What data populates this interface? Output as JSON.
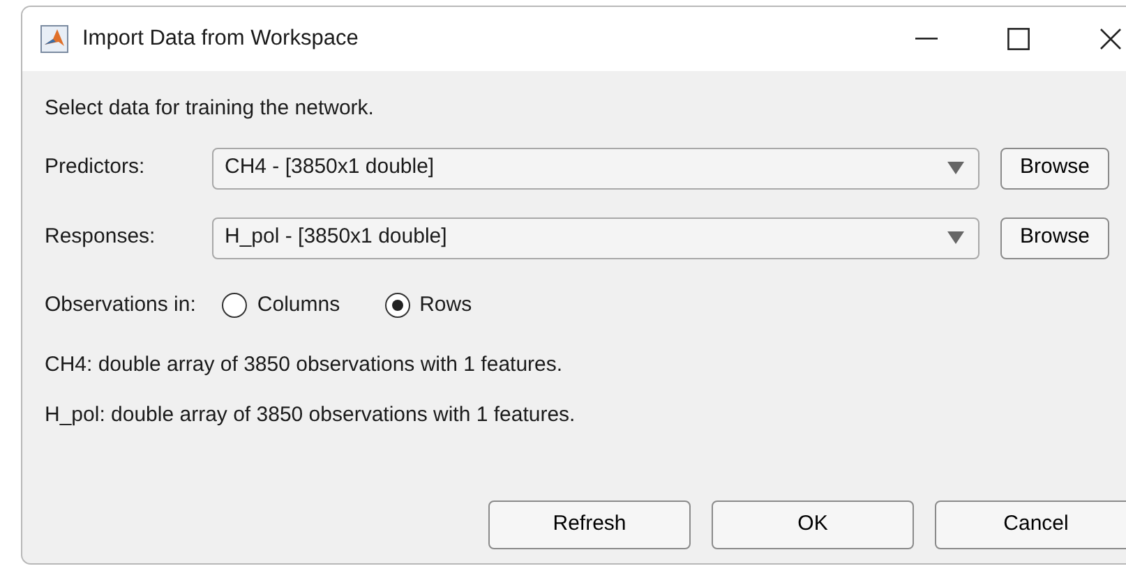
{
  "window": {
    "title": "Import Data from Workspace"
  },
  "instruction": "Select data for training the network.",
  "fields": [
    {
      "label": "Predictors:",
      "value": "CH4 - [3850x1 double]",
      "button": "Browse"
    },
    {
      "label": "Responses:",
      "value": "H_pol - [3850x1 double]",
      "button": "Browse"
    }
  ],
  "observations": {
    "label": "Observations in:",
    "options": [
      {
        "label": "Columns",
        "selected": false
      },
      {
        "label": "Rows",
        "selected": true
      }
    ]
  },
  "info": [
    "CH4: double array of 3850 observations with 1 features.",
    "H_pol: double array of 3850 observations with 1 features."
  ],
  "buttons": [
    "Refresh",
    "OK",
    "Cancel"
  ]
}
